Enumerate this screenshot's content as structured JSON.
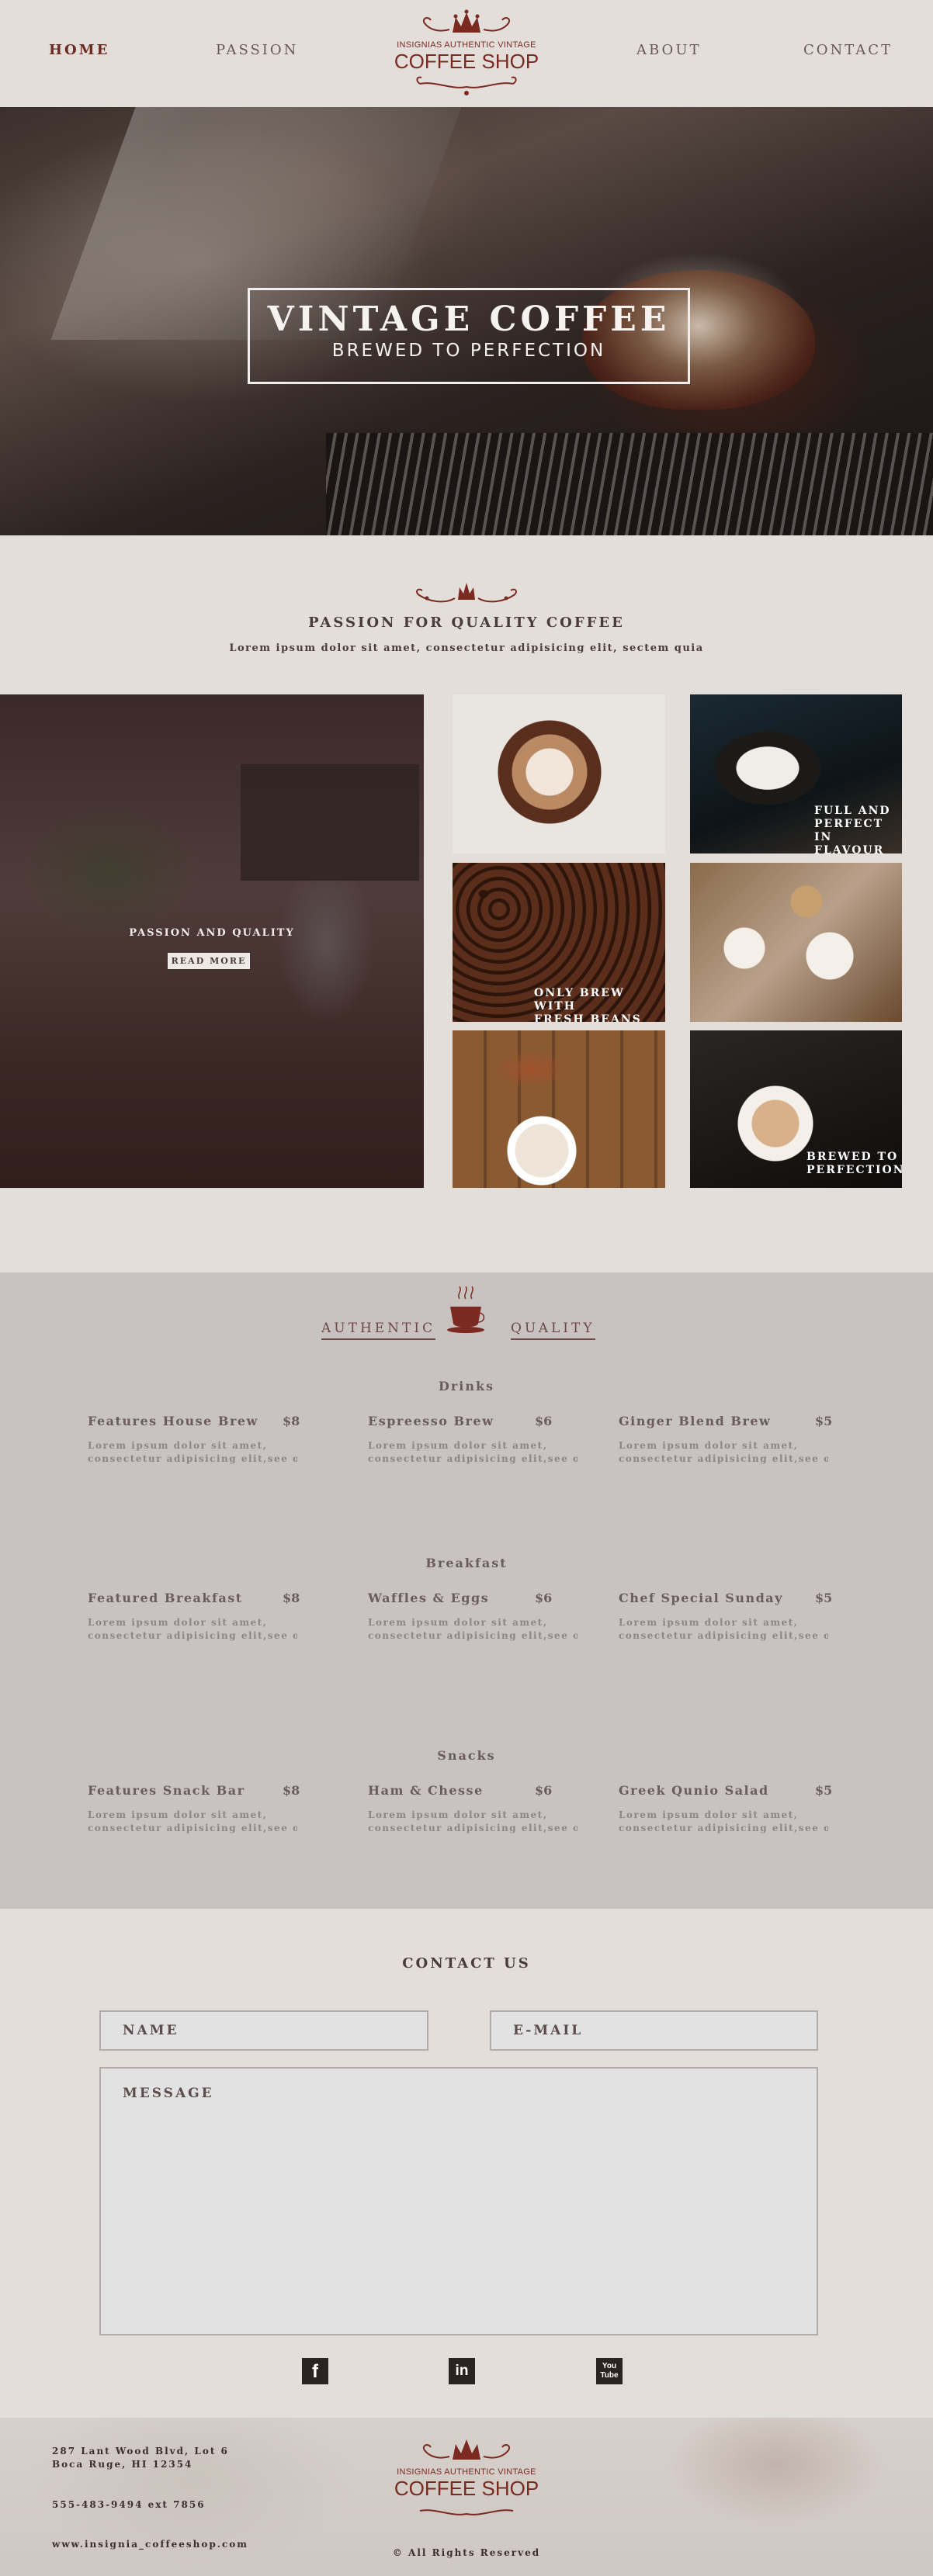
{
  "nav": {
    "items": [
      {
        "label": "HOME",
        "active": true
      },
      {
        "label": "PASSION",
        "active": false
      },
      {
        "label": "ABOUT",
        "active": false
      },
      {
        "label": "CONTACT",
        "active": false
      }
    ],
    "logo": {
      "line1": "INSIGNIAS AUTHENTIC VINTAGE",
      "line2": "COFFEE SHOP",
      "icon": "crown-icon"
    }
  },
  "hero": {
    "title": "VINTAGE COFFEE",
    "subtitle": "BREWED TO PERFECTION"
  },
  "passion": {
    "title": "PASSION FOR QUALITY COFFEE",
    "subtitle": "Lorem ipsum dolor sit amet, consectetur adipisicing elit, sectem quia",
    "feature": {
      "label": "PASSION AND QUALITY",
      "button": "READ MORE"
    },
    "tiles": [
      {
        "caption": ""
      },
      {
        "caption": "FULL AND\nPERFECT IN\nFLAVOUR"
      },
      {
        "caption": "ONLY BREW WITH\nFRESH BEANS"
      },
      {
        "caption": ""
      },
      {
        "caption": ""
      },
      {
        "caption": "BREWED TO\nPERFECTION"
      }
    ]
  },
  "menu": {
    "heading_left": "AUTHENTIC",
    "heading_right": "QUALITY",
    "heading_icon": "coffee-cup-icon",
    "categories": [
      {
        "name": "Drinks",
        "items": [
          {
            "name": "Features House Brew",
            "price": "$8",
            "desc1": "Lorem ipsum dolor sit amet,",
            "desc2": "consectetur adipisicing elit,see oc"
          },
          {
            "name": "Espreesso Brew",
            "price": "$6",
            "desc1": "Lorem ipsum dolor sit amet,",
            "desc2": "consectetur adipisicing elit,see oc"
          },
          {
            "name": "Ginger Blend Brew",
            "price": "$5",
            "desc1": "Lorem ipsum dolor sit amet,",
            "desc2": "consectetur adipisicing elit,see oc"
          }
        ]
      },
      {
        "name": "Breakfast",
        "items": [
          {
            "name": "Featured Breakfast",
            "price": "$8",
            "desc1": "Lorem ipsum dolor sit amet,",
            "desc2": "consectetur adipisicing elit,see oc"
          },
          {
            "name": "Waffles & Eggs",
            "price": "$6",
            "desc1": "Lorem ipsum dolor sit amet,",
            "desc2": "consectetur adipisicing elit,see oc"
          },
          {
            "name": "Chef Special Sunday",
            "price": "$5",
            "desc1": "Lorem ipsum dolor sit amet,",
            "desc2": "consectetur adipisicing elit,see oc"
          }
        ]
      },
      {
        "name": "Snacks",
        "items": [
          {
            "name": "Features Snack Bar",
            "price": "$8",
            "desc1": "Lorem ipsum dolor sit amet,",
            "desc2": "consectetur adipisicing elit,see oc"
          },
          {
            "name": "Ham & Chesse",
            "price": "$6",
            "desc1": "Lorem ipsum dolor sit amet,",
            "desc2": "consectetur adipisicing elit,see oc"
          },
          {
            "name": "Greek Qunio Salad",
            "price": "$5",
            "desc1": "Lorem ipsum dolor sit amet,",
            "desc2": "consectetur adipisicing elit,see oc"
          }
        ]
      }
    ]
  },
  "contact": {
    "title": "CONTACT US",
    "name_placeholder": "NAME",
    "email_placeholder": "E-MAIL",
    "message_placeholder": "MESSAGE",
    "social": [
      {
        "icon": "facebook-icon",
        "glyph": "f"
      },
      {
        "icon": "linkedin-icon",
        "glyph": "in"
      },
      {
        "icon": "youtube-icon",
        "glyph": "You Tube"
      }
    ]
  },
  "footer": {
    "address1": "287 Lant Wood Blvd, Lot 6",
    "address2": "Boca Ruge, HI 12354",
    "phone": "555-483-9494 ext 7856",
    "web": "www.insignia_coffeeshop.com",
    "rights": "© All Rights Reserved",
    "logo_line1": "INSIGNIAS AUTHENTIC VINTAGE",
    "logo_line2": "COFFEE SHOP"
  },
  "colors": {
    "accent": "#6b2a22",
    "background": "#e4dedb",
    "menu_bg": "#c8c3c1",
    "text": "#4a3c3c"
  }
}
